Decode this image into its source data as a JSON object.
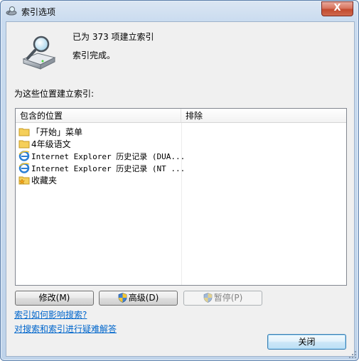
{
  "window": {
    "title": "索引选项",
    "close_glyph": "X"
  },
  "status": {
    "count_line": "已为 373 项建立索引",
    "state_line": "索引完成。"
  },
  "section_label": "为这些位置建立索引:",
  "table": {
    "columns": [
      "包含的位置",
      "排除"
    ],
    "rows": [
      {
        "icon": "folder-icon",
        "label": "「开始」菜单",
        "mono": false
      },
      {
        "icon": "folder-icon",
        "label": "4年级语文",
        "mono": false
      },
      {
        "icon": "ie-icon",
        "label": "Internet Explorer 历史记录 (DUA...",
        "mono": true
      },
      {
        "icon": "ie-icon",
        "label": "Internet Explorer 历史记录 (NT ...",
        "mono": true
      },
      {
        "icon": "favorites-folder-icon",
        "label": "收藏夹",
        "mono": false
      }
    ]
  },
  "buttons": {
    "modify": "修改(M)",
    "advanced": "高级(D)",
    "pause": "暂停(P)",
    "close": "关闭"
  },
  "links": {
    "how_affects": "索引如何影响搜索?",
    "troubleshoot": "对搜索和索引进行疑难解答"
  }
}
